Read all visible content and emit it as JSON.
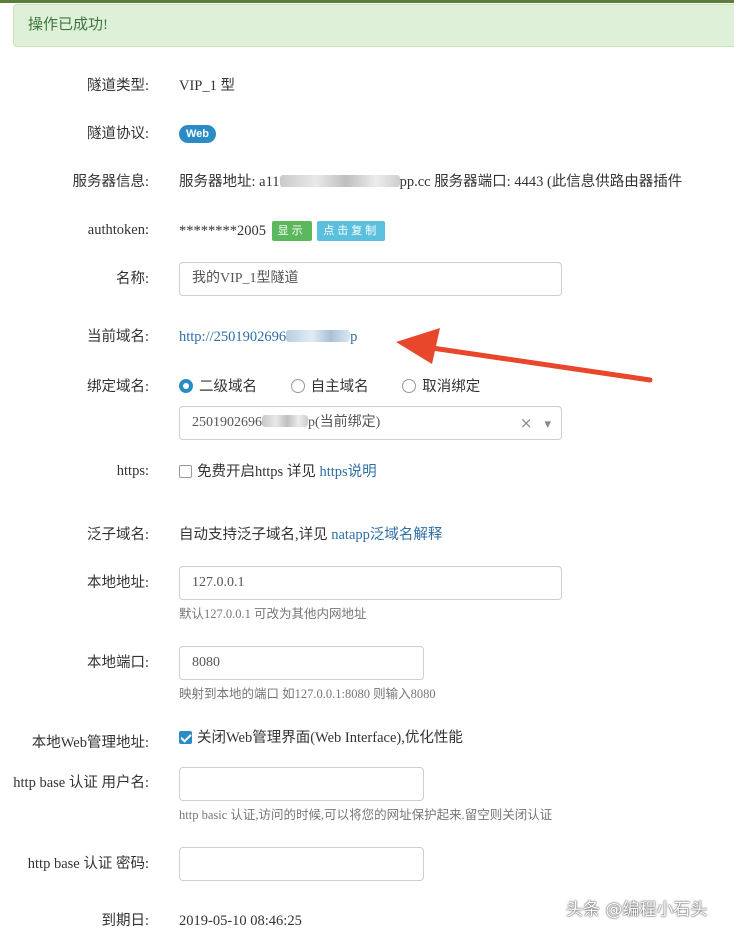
{
  "alert": {
    "message": "操作已成功!"
  },
  "fields": {
    "tunnel_type": {
      "label": "隧道类型:",
      "value": "VIP_1 型"
    },
    "tunnel_protocol": {
      "label": "隧道协议:",
      "badge": "Web"
    },
    "server_info": {
      "label": "服务器信息:",
      "addr_prefix": "服务器地址: a11",
      "addr_suffix": "pp.cc",
      "port_text": "服务器端口: 4443 (此信息供路由器插件"
    },
    "authtoken": {
      "label": "authtoken:",
      "value": "********2005",
      "show_button": "显示",
      "copy_button": "点击复制"
    },
    "name": {
      "label": "名称:",
      "value": "我的VIP_1型隧道"
    },
    "current_domain": {
      "label": "当前域名:",
      "value_prefix": "http://2501902696",
      "value_suffix": "p"
    },
    "bind_domain": {
      "label": "绑定域名:",
      "options": [
        "二级域名",
        "自主域名",
        "取消绑定"
      ],
      "selected_prefix": "2501902696",
      "selected_suffix": "p(当前绑定)",
      "clear_glyph": "×",
      "caret_glyph": "▾"
    },
    "https": {
      "label": "https:",
      "text": "免费开启https 详见 ",
      "link": "https说明"
    },
    "wildcard": {
      "label": "泛子域名:",
      "text": "自动支持泛子域名,详见 ",
      "link": "natapp泛域名解释"
    },
    "local_addr": {
      "label": "本地地址:",
      "value": "127.0.0.1",
      "help": "默认127.0.0.1 可改为其他内网地址"
    },
    "local_port": {
      "label": "本地端口:",
      "value": "8080",
      "help": "映射到本地的端口 如127.0.0.1:8080 则输入8080"
    },
    "web_admin": {
      "label": "本地Web管理地址:",
      "text": "关闭Web管理界面(Web Interface),优化性能"
    },
    "http_user": {
      "label": "http base 认证 用户名:",
      "value": "",
      "help": "http basic 认证,访问的时候,可以将您的网址保护起来.留空则关闭认证"
    },
    "http_pass": {
      "label": "http base 认证 密码:",
      "value": ""
    },
    "expire": {
      "label": "到期日:",
      "value": "2019-05-10 08:46:25"
    }
  },
  "watermark": "头条 @编程小石头",
  "colors": {
    "accent": "#2b8bc5",
    "success_bg": "#dff0d8",
    "arrow": "#e8472b"
  }
}
